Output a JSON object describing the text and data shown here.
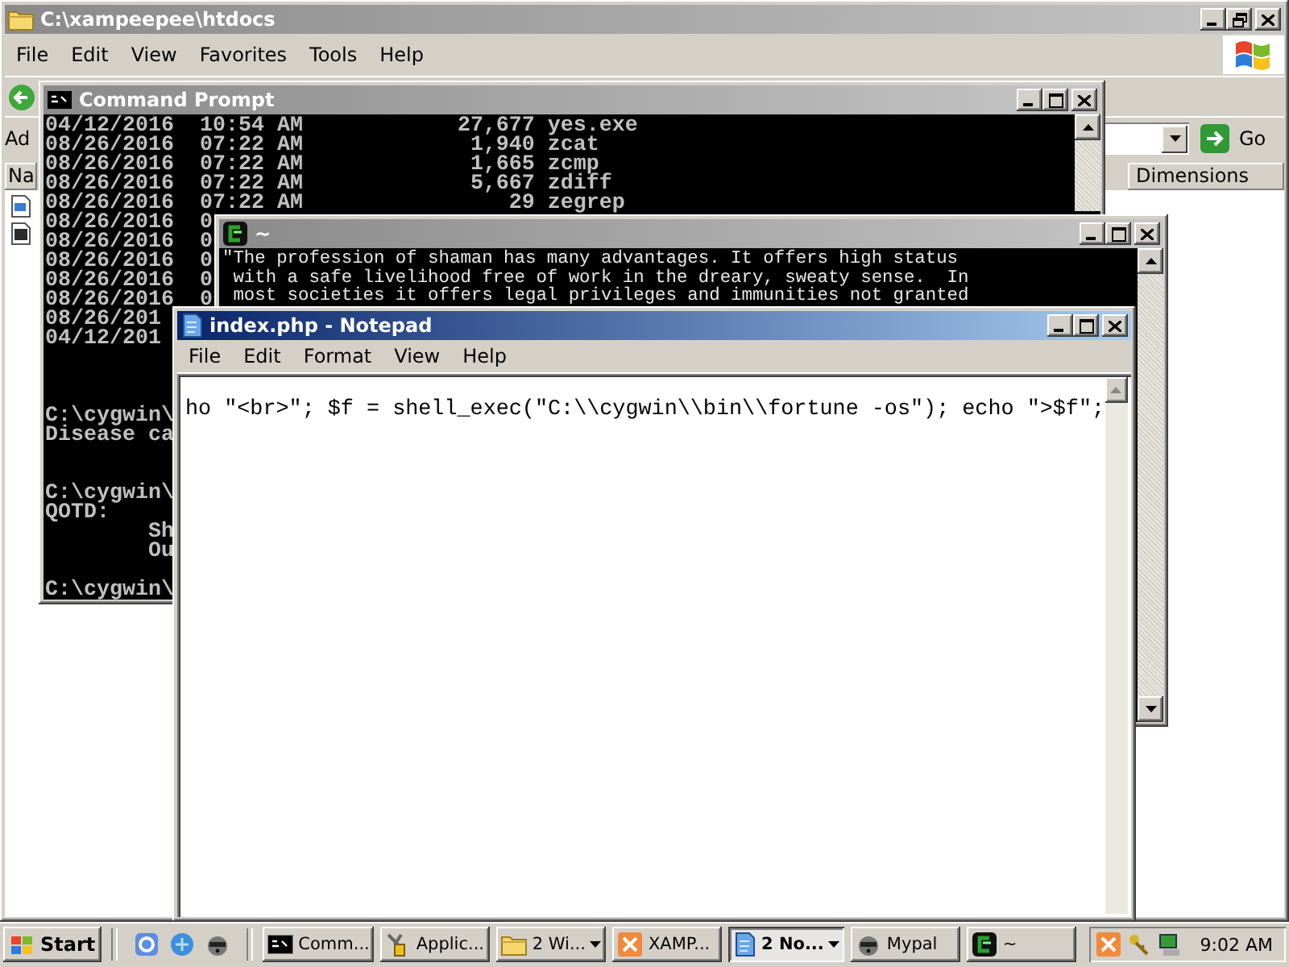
{
  "explorer": {
    "title": "C:\\xampeepee\\htdocs",
    "active": false,
    "menu": [
      "File",
      "Edit",
      "View",
      "Favorites",
      "Tools",
      "Help"
    ],
    "address_label": "Ad",
    "go_button": "Go",
    "columns": [
      "Na",
      "Dimensions"
    ]
  },
  "command_prompt": {
    "title": "Command Prompt",
    "active": false,
    "output": "04/12/2016  10:54 AM            27,677 yes.exe\n08/26/2016  07:22 AM             1,940 zcat\n08/26/2016  07:22 AM             1,665 zcmp\n08/26/2016  07:22 AM             5,667 zdiff\n08/26/2016  07:22 AM                29 zegrep\n08/26/2016  0\n08/26/2016  0\n08/26/2016  0\n08/26/2016  0\n08/26/2016  0\n08/26/201\n04/12/201\n\n\n\nC:\\cygwin\\\nDisease ca\n\n\nC:\\cygwin\\\nQOTD:\n        Sh\n        Ou\n\nC:\\cygwin\\"
  },
  "cygwin": {
    "title": "~",
    "active": false,
    "output": "\"The profession of shaman has many advantages. It offers high status\n with a safe livelihood free of work in the dreary, sweaty sense.  In\n most societies it offers legal privileges and immunities not granted"
  },
  "notepad": {
    "title": "index.php - Notepad",
    "active": true,
    "menu": [
      "File",
      "Edit",
      "Format",
      "View",
      "Help"
    ],
    "text": "ho \"<br>\"; $f = shell_exec(\"C:\\\\cygwin\\\\bin\\\\fortune -os\"); echo \">$f\";"
  },
  "taskbar": {
    "start": "Start",
    "tasks": [
      {
        "label": "Comm...",
        "kind": "console",
        "grouped": false,
        "selected": false
      },
      {
        "label": "Applic...",
        "kind": "tools",
        "grouped": false,
        "selected": false
      },
      {
        "label": "2 Wi...",
        "kind": "folder",
        "grouped": true,
        "selected": false
      },
      {
        "label": "XAMP...",
        "kind": "xampp",
        "grouped": false,
        "selected": false
      },
      {
        "label": "2 No...",
        "kind": "notepad",
        "grouped": true,
        "selected": true
      },
      {
        "label": "Mypal",
        "kind": "mypal",
        "grouped": false,
        "selected": false
      },
      {
        "label": "~",
        "kind": "cygwin",
        "grouped": false,
        "selected": false
      }
    ],
    "clock": "9:02 AM"
  }
}
